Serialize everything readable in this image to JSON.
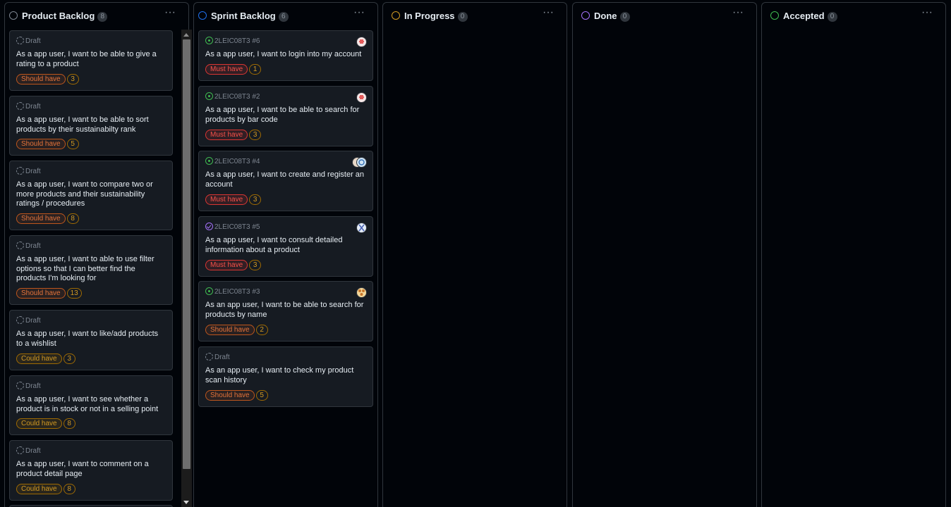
{
  "colors": {
    "background": "#010409",
    "card": "#161b22",
    "border": "#30363d",
    "should_have": "#e3733a",
    "must_have": "#f85149",
    "could_have": "#d29922"
  },
  "columns": [
    {
      "title": "Product Backlog",
      "count": "8",
      "status_color": "#7d8590",
      "menu": "···",
      "cards": [
        {
          "meta": "Draft",
          "icon": "draft-icon",
          "title": "As a app user, I want to be able to give a rating to a product",
          "label": "Should have",
          "estimate": "3"
        },
        {
          "meta": "Draft",
          "icon": "draft-icon",
          "title": "As a app user, I want to be able to sort products by their sustainabilty rank",
          "label": "Should have",
          "estimate": "5"
        },
        {
          "meta": "Draft",
          "icon": "draft-icon",
          "title": "As a app user, I want to compare two or more products and their sustainability ratings / procedures",
          "label": "Should have",
          "estimate": "8"
        },
        {
          "meta": "Draft",
          "icon": "draft-icon",
          "title": "As a app user, I want to able to use filter options so that I can better find the products I'm looking for",
          "label": "Should have",
          "estimate": "13"
        },
        {
          "meta": "Draft",
          "icon": "draft-icon",
          "title": "As a app user, I want to like/add products to a wishlist",
          "label": "Could have",
          "estimate": "3"
        },
        {
          "meta": "Draft",
          "icon": "draft-icon",
          "title": "As a app user, I want to see whether a product is in stock or not in a selling point",
          "label": "Could have",
          "estimate": "8"
        },
        {
          "meta": "Draft",
          "icon": "draft-icon",
          "title": "As a app user, I want to comment on a product detail page",
          "label": "Could have",
          "estimate": "8"
        }
      ]
    },
    {
      "title": "Sprint Backlog",
      "count": "6",
      "status_color": "#1f6feb",
      "menu": "···",
      "cards": [
        {
          "meta": "2LEIC08T3 #6",
          "icon": "open-issue-icon",
          "title": "As a app user, I want to login into my account",
          "label": "Must have",
          "estimate": "1"
        },
        {
          "meta": "2LEIC08T3 #2",
          "icon": "open-issue-icon",
          "title": "As a app user, I want to be able to search for products by bar code",
          "label": "Must have",
          "estimate": "3"
        },
        {
          "meta": "2LEIC08T3 #4",
          "icon": "open-issue-icon",
          "title": "As a app user, I want to create and register an account",
          "label": "Must have",
          "estimate": "3"
        },
        {
          "meta": "2LEIC08T3 #5",
          "icon": "closed-issue-icon",
          "title": "As a app user, I want to consult detailed information about a product",
          "label": "Must have",
          "estimate": "3"
        },
        {
          "meta": "2LEIC08T3 #3",
          "icon": "open-issue-icon",
          "title": "As an app user, I want to be able to search for products by name",
          "label": "Should have",
          "estimate": "2"
        },
        {
          "meta": "Draft",
          "icon": "draft-icon",
          "title": "As an app user, I want to check my product scan history",
          "label": "Should have",
          "estimate": "5"
        }
      ]
    },
    {
      "title": "In Progress",
      "count": "0",
      "status_color": "#d29922",
      "menu": "···",
      "cards": []
    },
    {
      "title": "Done",
      "count": "0",
      "status_color": "#a371f7",
      "menu": "···",
      "cards": []
    },
    {
      "title": "Accepted",
      "count": "0",
      "status_color": "#3fb950",
      "menu": "···",
      "cards": []
    }
  ]
}
